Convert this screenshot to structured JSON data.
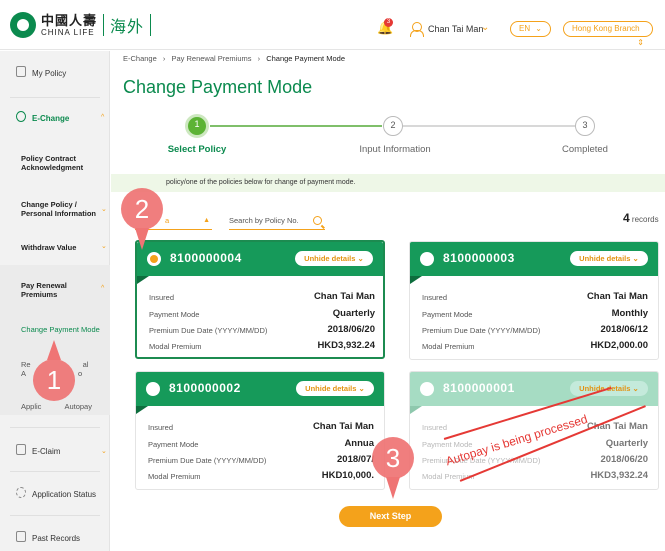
{
  "header": {
    "logo_cn": "中國人壽",
    "logo_en": "CHINA LIFE",
    "logo_sub": "海外",
    "notification_count": "3",
    "user_name": "Chan Tai Man",
    "language": "EN",
    "branch": "Hong Kong Branch"
  },
  "sidebar": {
    "my_policy": "My Policy",
    "echange": "E-Change",
    "policy_contract": "Policy Contract Acknowledgment",
    "change_policy": "Change Policy / Personal Information",
    "withdraw_value": "Withdraw Value",
    "pay_renewal": "Pay Renewal Premiums",
    "change_payment_mode": "Change Payment Mode",
    "renewal_partial_1": "Re",
    "renewal_partial_2": "A",
    "renewal_partial_3": "al",
    "renewal_partial_4": "o",
    "appl_partial": "Applic",
    "autopay_partial": "Autopay",
    "eclaim": "E-Claim",
    "application_status": "Application Status",
    "past_records": "Past Records"
  },
  "breadcrumb": {
    "item1": "E-Change",
    "item2": "Pay Renewal Premiums",
    "current": "Change Payment Mode"
  },
  "page_title": "Change Payment Mode",
  "steps": [
    {
      "num": "1",
      "label": "Select Policy"
    },
    {
      "num": "2",
      "label": "Input Information"
    },
    {
      "num": "3",
      "label": "Completed"
    }
  ],
  "instruction": "policy/one of the policies below for change of payment mode.",
  "filter": {
    "select_value": "a",
    "search_placeholder": "Search by Policy No.",
    "records_count": "4",
    "records_label": "records"
  },
  "card_labels": {
    "insured": "Insured",
    "payment_mode": "Payment Mode",
    "due_date": "Premium Due Date (YYYY/MM/DD)",
    "modal_premium": "Modal Premium",
    "unhide": "Unhide details"
  },
  "cards": [
    {
      "policy_no": "8100000004",
      "insured": "Chan Tai Man",
      "payment_mode": "Quarterly",
      "due_date": "2018/06/20",
      "premium": "HKD3,932.24"
    },
    {
      "policy_no": "8100000003",
      "insured": "Chan Tai Man",
      "payment_mode": "Monthly",
      "due_date": "2018/06/12",
      "premium": "HKD2,000.00"
    },
    {
      "policy_no": "8100000002",
      "insured": "Chan Tai Man",
      "payment_mode": "Annua",
      "due_date": "2018/07/",
      "premium": "HKD10,000."
    },
    {
      "policy_no": "8100000001",
      "insured": "Chan Tai Man",
      "payment_mode": "Quarterly",
      "due_date": "2018/06/20",
      "premium": "HKD3,932.24"
    }
  ],
  "autopay_stamp": "Autopay is being processed",
  "next_button": "Next Step",
  "markers": [
    "1",
    "2",
    "3"
  ]
}
